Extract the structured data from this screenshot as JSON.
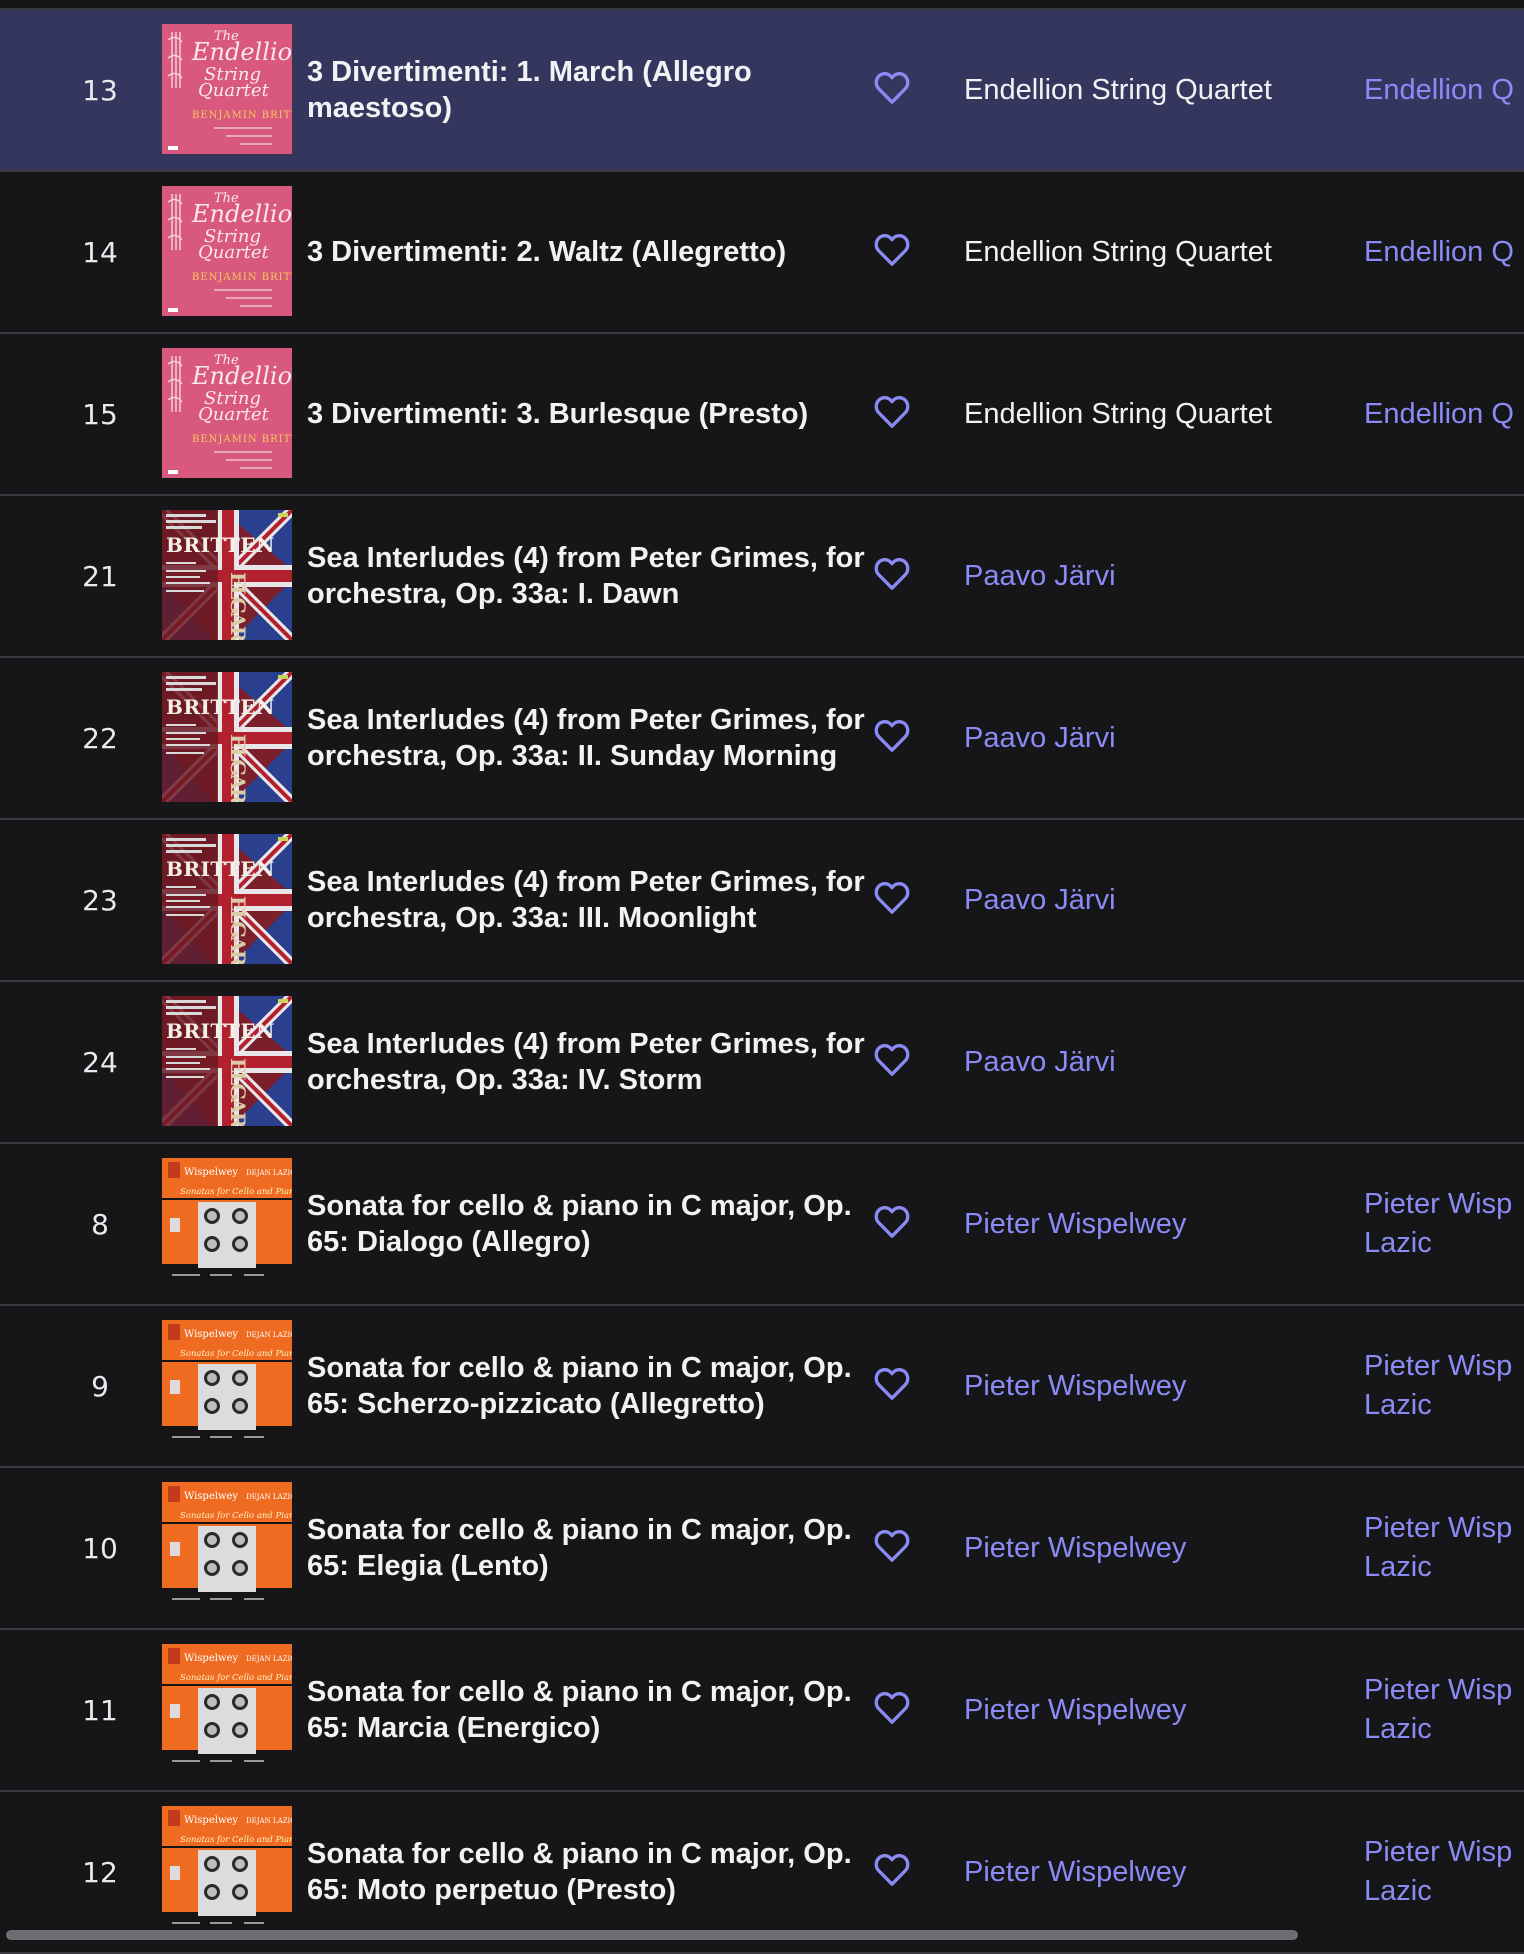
{
  "colors": {
    "background": "#161618",
    "active_row": "#35365e",
    "link": "#8b8bf5",
    "text": "#f2f2f5",
    "heart": "#8b8bf5"
  },
  "tracks": [
    {
      "number": "13",
      "title": "3 Divertimenti: 1. March (Allegro maestoso)",
      "artist": "Endellion String Quartet",
      "artist_is_link": false,
      "album_artist": "Endellion Q",
      "cover": "endellion",
      "active": true,
      "cover_text": {
        "line1": "The",
        "line2": "Endellion",
        "line3": "String",
        "line4": "Quartet",
        "line5": "BENJAMIN BRITTEN"
      }
    },
    {
      "number": "14",
      "title": "3 Divertimenti: 2. Waltz (Allegretto)",
      "artist": "Endellion String Quartet",
      "artist_is_link": false,
      "album_artist": "Endellion Q",
      "cover": "endellion",
      "active": false,
      "cover_text": {
        "line1": "The",
        "line2": "Endellion",
        "line3": "String",
        "line4": "Quartet",
        "line5": "BENJAMIN BRITTEN"
      }
    },
    {
      "number": "15",
      "title": "3 Divertimenti: 3. Burlesque (Presto)",
      "artist": "Endellion String Quartet",
      "artist_is_link": false,
      "album_artist": "Endellion Q",
      "cover": "endellion",
      "active": false,
      "cover_text": {
        "line1": "The",
        "line2": "Endellion",
        "line3": "String",
        "line4": "Quartet",
        "line5": "BENJAMIN BRITTEN"
      }
    },
    {
      "number": "21",
      "title": "Sea Interludes (4) from Peter Grimes, for orchestra, Op. 33a: I. Dawn",
      "artist": "Paavo Järvi",
      "artist_is_link": true,
      "album_artist": "",
      "cover": "britten",
      "active": false,
      "cover_text": {
        "line1": "BRITTEN",
        "line2": "ELGAR"
      }
    },
    {
      "number": "22",
      "title": "Sea Interludes (4) from Peter Grimes, for orchestra, Op. 33a: II. Sunday Morning",
      "artist": "Paavo Järvi",
      "artist_is_link": true,
      "album_artist": "",
      "cover": "britten",
      "active": false,
      "cover_text": {
        "line1": "BRITTEN",
        "line2": "ELGAR"
      }
    },
    {
      "number": "23",
      "title": "Sea Interludes (4) from Peter Grimes, for orchestra, Op. 33a: III. Moonlight",
      "artist": "Paavo Järvi",
      "artist_is_link": true,
      "album_artist": "",
      "cover": "britten",
      "active": false,
      "cover_text": {
        "line1": "BRITTEN",
        "line2": "ELGAR"
      }
    },
    {
      "number": "24",
      "title": "Sea Interludes (4) from Peter Grimes, for orchestra, Op. 33a: IV. Storm",
      "artist": "Paavo Järvi",
      "artist_is_link": true,
      "album_artist": "",
      "cover": "britten",
      "active": false,
      "cover_text": {
        "line1": "BRITTEN",
        "line2": "ELGAR"
      }
    },
    {
      "number": "8",
      "title": "Sonata for cello & piano in C major, Op. 65: Dialogo (Allegro)",
      "artist": "Pieter Wispelwey",
      "artist_is_link": true,
      "album_artist": "Pieter Wisp\nLazic",
      "cover": "wispelwey",
      "active": false,
      "cover_text": {
        "line1": "Wispelwey",
        "line2": "DEJAN LAZIĆ",
        "line3": "Sonatas for Cello and Piano"
      }
    },
    {
      "number": "9",
      "title": "Sonata for cello & piano in C major, Op. 65: Scherzo-pizzicato (Allegretto)",
      "artist": "Pieter Wispelwey",
      "artist_is_link": true,
      "album_artist": "Pieter Wisp\nLazic",
      "cover": "wispelwey",
      "active": false,
      "cover_text": {
        "line1": "Wispelwey",
        "line2": "DEJAN LAZIĆ",
        "line3": "Sonatas for Cello and Piano"
      }
    },
    {
      "number": "10",
      "title": "Sonata for cello & piano in C major, Op. 65: Elegia (Lento)",
      "artist": "Pieter Wispelwey",
      "artist_is_link": true,
      "album_artist": "Pieter Wisp\nLazic",
      "cover": "wispelwey",
      "active": false,
      "cover_text": {
        "line1": "Wispelwey",
        "line2": "DEJAN LAZIĆ",
        "line3": "Sonatas for Cello and Piano"
      }
    },
    {
      "number": "11",
      "title": "Sonata for cello & piano in C major, Op. 65: Marcia (Energico)",
      "artist": "Pieter Wispelwey",
      "artist_is_link": true,
      "album_artist": "Pieter Wisp\nLazic",
      "cover": "wispelwey",
      "active": false,
      "cover_text": {
        "line1": "Wispelwey",
        "line2": "DEJAN LAZIĆ",
        "line3": "Sonatas for Cello and Piano"
      }
    },
    {
      "number": "12",
      "title": "Sonata for cello & piano in C major, Op. 65: Moto perpetuo (Presto)",
      "artist": "Pieter Wispelwey",
      "artist_is_link": true,
      "album_artist": "Pieter Wisp\nLazic",
      "cover": "wispelwey",
      "active": false,
      "cover_text": {
        "line1": "Wispelwey",
        "line2": "DEJAN LAZIĆ",
        "line3": "Sonatas for Cello and Piano"
      }
    }
  ],
  "icons": {
    "favorite": "heart-outline-icon"
  }
}
